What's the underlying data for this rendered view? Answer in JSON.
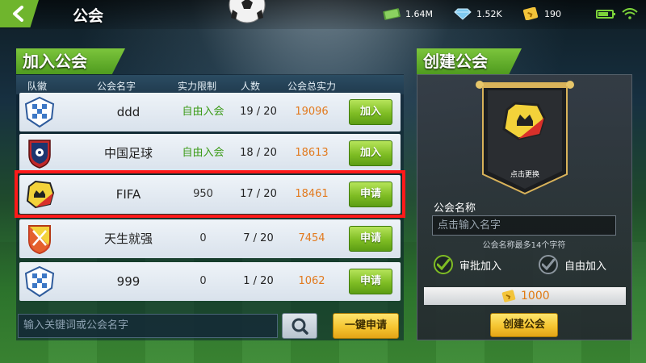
{
  "header": {
    "title": "公会",
    "resources": [
      {
        "icon": "cash-icon",
        "value": "1.64M"
      },
      {
        "icon": "diamond-icon",
        "value": "1.52K"
      },
      {
        "icon": "ticket-icon",
        "value": "190"
      }
    ]
  },
  "join": {
    "title": "加入公会",
    "columns": [
      "队徽",
      "公会名字",
      "实力限制",
      "人数",
      "公会总实力"
    ],
    "rows": [
      {
        "name": "ddd",
        "limit": "自由入会",
        "members": "19 / 20",
        "power": "19096",
        "action": "加入",
        "badge": "blue-check-shield"
      },
      {
        "name": "中国足球",
        "limit": "自由入会",
        "members": "18 / 20",
        "power": "18613",
        "action": "加入",
        "badge": "navy-red-shield"
      },
      {
        "name": "FIFA",
        "limit": "950",
        "members": "17 / 20",
        "power": "18461",
        "action": "申请",
        "badge": "yellow-red-crown"
      },
      {
        "name": "天生就强",
        "limit": "0",
        "members": "7 / 20",
        "power": "7454",
        "action": "申请",
        "badge": "yellow-red-swords"
      },
      {
        "name": "999",
        "limit": "0",
        "members": "1 / 20",
        "power": "1062",
        "action": "申请",
        "badge": "blue-check-shield"
      }
    ],
    "search_placeholder": "输入关键词或公会名字",
    "one_key_apply": "一键申请"
  },
  "create": {
    "title": "创建公会",
    "change_emblem": "点击更换",
    "name_label": "公会名称",
    "name_placeholder": "点击输入名字",
    "name_hint": "公会名称最多14个字符",
    "options": [
      {
        "label": "审批加入",
        "checked": true
      },
      {
        "label": "自由加入",
        "checked": false
      }
    ],
    "cost": "1000",
    "button": "创建公会"
  },
  "colors": {
    "accent_green": "#7fbd24",
    "power_orange": "#e27a1e",
    "free_join_green": "#3a9a16",
    "highlight_red": "#ff1a1a"
  }
}
